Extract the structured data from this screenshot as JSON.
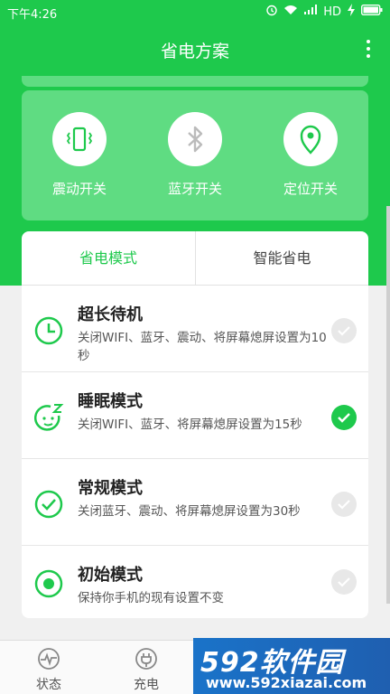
{
  "status_bar": {
    "time": "下午4:26",
    "network": "HD"
  },
  "title_bar": {
    "title": "省电方案"
  },
  "switches": [
    {
      "label": "震动开关",
      "icon": "vibrate-icon"
    },
    {
      "label": "蓝牙开关",
      "icon": "bluetooth-icon"
    },
    {
      "label": "定位开关",
      "icon": "location-pin-icon"
    }
  ],
  "tabs": [
    {
      "label": "省电模式",
      "selected": true
    },
    {
      "label": "智能省电",
      "selected": false
    }
  ],
  "modes": [
    {
      "name": "超长待机",
      "desc": "关闭WIFI、蓝牙、震动、将屏幕熄屏设置为10秒",
      "icon": "clock-icon",
      "checked": false
    },
    {
      "name": "睡眠模式",
      "desc": "关闭WIFI、蓝牙、将屏幕熄屏设置为15秒",
      "icon": "sleep-face-icon",
      "checked": true
    },
    {
      "name": "常规模式",
      "desc": "关闭蓝牙、震动、将屏幕熄屏设置为30秒",
      "icon": "check-circle-icon",
      "checked": false
    },
    {
      "name": "初始模式",
      "desc": "保持你手机的现有设置不变",
      "icon": "dot-circle-icon",
      "checked": false
    }
  ],
  "bottom_nav": [
    {
      "label": "状态",
      "icon": "pulse-icon"
    },
    {
      "label": "充电",
      "icon": "plug-icon"
    }
  ],
  "watermark": {
    "brand": "592软件园",
    "url": "www.592xiazai.com"
  },
  "colors": {
    "accent": "#1ec94c",
    "card": "#5fdc82"
  }
}
